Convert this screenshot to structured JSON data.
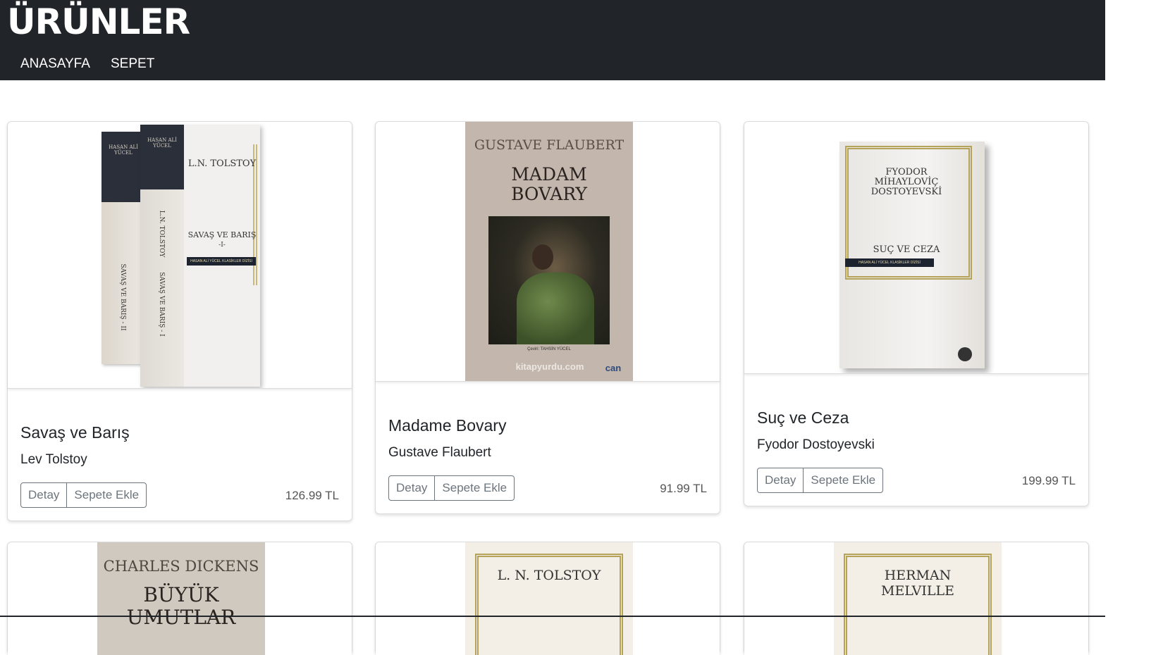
{
  "header": {
    "title": "ÜRÜNLER",
    "nav": {
      "home": "ANASAYFA",
      "cart": "SEPET"
    }
  },
  "buttons": {
    "detail": "Detay",
    "add_to_cart": "Sepete Ekle"
  },
  "products": [
    {
      "title": "Savaş ve Barış",
      "author": "Lev Tolstoy",
      "price": "126.99 TL",
      "cover": {
        "author": "L.N. TOLSTOY",
        "title": "SAVAŞ VE BARIŞ",
        "volume": "-I-",
        "series": "HASAN ALİ YÜCEL KLASİKLER DİZİSİ",
        "spine1": "SAVAŞ VE BARIŞ - I",
        "spine2": "SAVAŞ VE BARIŞ - II",
        "spine_author": "L.N. TOLSTOY",
        "spine_series": "HASAN ALİ YÜCEL"
      }
    },
    {
      "title": "Madame Bovary",
      "author": "Gustave Flaubert",
      "price": "91.99 TL",
      "cover": {
        "author": "GUSTAVE FLAUBERT",
        "title_line1": "MADAM",
        "title_line2": "BOVARY",
        "translator": "Çeviri: TAHSİN YÜCEL",
        "watermark": "kitapyurdu.com",
        "publisher": "can"
      }
    },
    {
      "title": "Suç ve Ceza",
      "author": "Fyodor Dostoyevski",
      "price": "199.99 TL",
      "cover": {
        "author_line1": "FYODOR",
        "author_line2": "MİHAYLOVİÇ",
        "author_line3": "DOSTOYEVSKİ",
        "title": "SUÇ VE CEZA",
        "series": "HASAN ALİ YÜCEL KLASİKLER DİZİSİ"
      }
    },
    {
      "cover": {
        "author": "CHARLES DICKENS",
        "title_line1": "BÜYÜK",
        "title_line2": "UMUTLAR"
      }
    },
    {
      "cover": {
        "author": "L. N. TOLSTOY"
      }
    },
    {
      "cover": {
        "author_line1": "HERMAN",
        "author_line2": "MELVILLE"
      }
    }
  ],
  "colors": {
    "navbar": "#212529",
    "button_outline": "#6c757d"
  }
}
